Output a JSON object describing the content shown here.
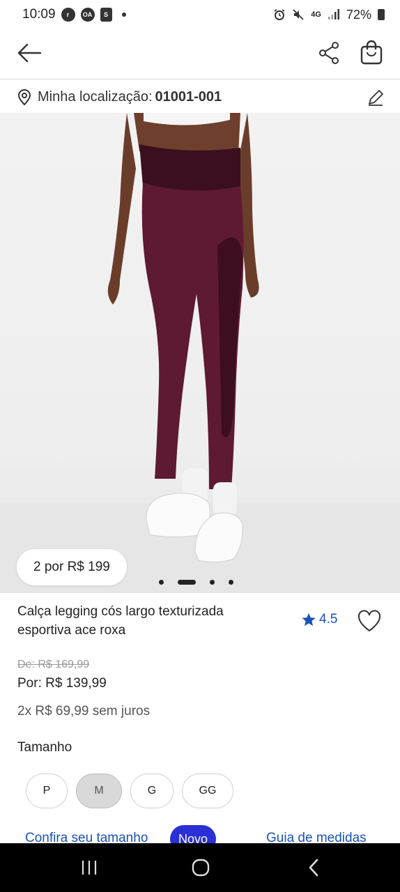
{
  "status_bar": {
    "time": "10:09",
    "app_icons": [
      "r",
      "OA",
      "S"
    ],
    "network": "4G",
    "battery": "72%"
  },
  "location": {
    "label": "Minha localização:",
    "cep": "01001-001"
  },
  "hero": {
    "promo": "2 por R$ 199",
    "slides": 4,
    "active_slide": 2
  },
  "product": {
    "title": "Calça legging cós largo texturizada esportiva ace roxa",
    "rating": "4.5",
    "old_price": "De: R$ 169,99",
    "price": "Por: R$ 139,99",
    "installments": "2x R$ 69,99 sem juros"
  },
  "sizes": {
    "label": "Tamanho",
    "options": [
      "P",
      "M",
      "G",
      "GG"
    ],
    "selected": "M"
  },
  "links": {
    "check_size": "Confira seu tamanho",
    "new_badge": "Novo",
    "size_guide": "Guia de medidas"
  },
  "colors": {
    "accent_blue": "#1a52b6",
    "badge_blue": "#2a2fd6",
    "legging_purple": "#5e1a33"
  }
}
